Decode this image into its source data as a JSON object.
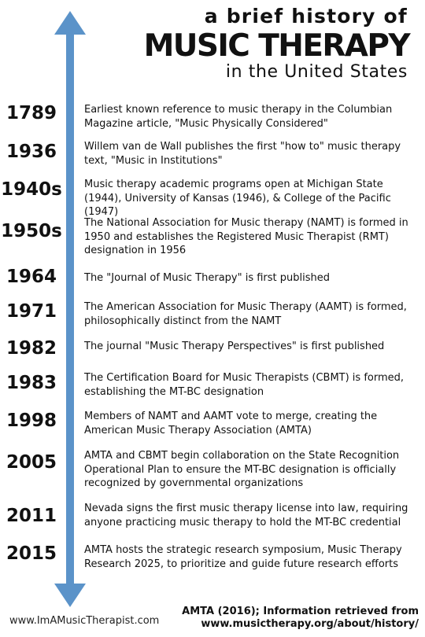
{
  "title": {
    "line1": "a brief history of",
    "line2": "MUSIC THERAPY",
    "line3": "in the United States"
  },
  "timeline": [
    {
      "year": "1789",
      "text": "Earliest known reference to music therapy in the Columbian Magazine article, \"Music Physically Considered\""
    },
    {
      "year": "1936",
      "text": "Willem van de Wall publishes the first \"how to\" music therapy text, \"Music in Institutions\""
    },
    {
      "year": "1940s",
      "text": "Music therapy academic programs open at Michigan State (1944), University of Kansas (1946), & College of the Pacific (1947)"
    },
    {
      "year": "1950s",
      "text": "The National Association for Music therapy (NAMT) is formed in 1950 and establishes the Registered Music Therapist (RMT) designation in 1956"
    },
    {
      "year": "1964",
      "text": "The \"Journal of Music Therapy\" is first published"
    },
    {
      "year": "1971",
      "text": "The American Association for Music Therapy (AAMT) is formed, philosophically distinct from the NAMT"
    },
    {
      "year": "1982",
      "text": "The journal \"Music Therapy Perspectives\" is first published"
    },
    {
      "year": "1983",
      "text": "The Certification Board for Music Therapists (CBMT) is formed, establishing the MT-BC designation"
    },
    {
      "year": "1998",
      "text": "Members of NAMT and AAMT vote to merge, creating the American Music Therapy Association (AMTA)"
    },
    {
      "year": "2005",
      "text": "AMTA and CBMT begin collaboration on the State Recognition Operational Plan to ensure the MT-BC designation is officially recognized by governmental organizations"
    },
    {
      "year": "2011",
      "text": "Nevada signs the first music therapy license into law, requiring anyone practicing music therapy to hold the MT-BC credential"
    },
    {
      "year": "2015",
      "text": "AMTA hosts the strategic research symposium, Music Therapy Research 2025, to prioritize and guide future research efforts"
    }
  ],
  "footer": {
    "website": "www.ImAMusicTherapist.com",
    "source_line1": "AMTA (2016); Information retrieved from",
    "source_line2": "www.musictherapy.org/about/history/"
  },
  "colors": {
    "arrow": "#5b93c9",
    "text": "#111111"
  }
}
